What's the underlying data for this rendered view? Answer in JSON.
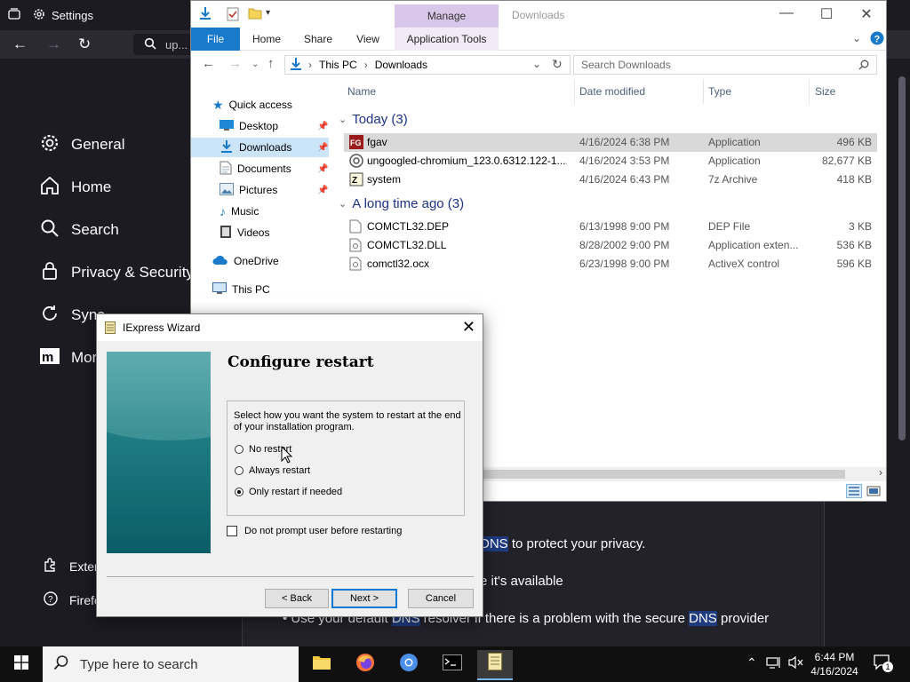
{
  "firefox": {
    "tab_title": "Settings",
    "url_partial": "up...",
    "categories": [
      "General",
      "Home",
      "Search",
      "Privacy & Security",
      "Sync",
      "More"
    ],
    "footer_links": [
      "Exter",
      "Firefo"
    ],
    "content": {
      "bullet1_highlight": "DNS",
      "bullet1_rest": " to protect your privacy.",
      "bullet2": "e it's available",
      "bullet3_a": "Use your default ",
      "bullet3_dns1": "DNS",
      "bullet3_b": " resolver if there is a problem with the secure ",
      "bullet3_dns2": "DNS",
      "bullet3_c": " provider"
    }
  },
  "explorer": {
    "window_title": "Downloads",
    "context_tab": "Manage",
    "ribbon_tabs": [
      "File",
      "Home",
      "Share",
      "View",
      "Application Tools"
    ],
    "breadcrumb": [
      "This PC",
      "Downloads"
    ],
    "search_placeholder": "Search Downloads",
    "columns": [
      "Name",
      "Date modified",
      "Type",
      "Size"
    ],
    "nav": [
      {
        "label": "Quick access",
        "pinned": false
      },
      {
        "label": "Desktop",
        "pinned": true
      },
      {
        "label": "Downloads",
        "pinned": true
      },
      {
        "label": "Documents",
        "pinned": true
      },
      {
        "label": "Pictures",
        "pinned": true
      },
      {
        "label": "Music",
        "pinned": false
      },
      {
        "label": "Videos",
        "pinned": false
      },
      {
        "label": "OneDrive",
        "pinned": false
      },
      {
        "label": "This PC",
        "pinned": false
      }
    ],
    "groups": [
      {
        "title": "Today (3)",
        "files": [
          {
            "name": "fgav",
            "date": "4/16/2024 6:38 PM",
            "type": "Application",
            "size": "496 KB"
          },
          {
            "name": "ungoogled-chromium_123.0.6312.122-1....",
            "date": "4/16/2024 3:53 PM",
            "type": "Application",
            "size": "82,677 KB"
          },
          {
            "name": "system",
            "date": "4/16/2024 6:43 PM",
            "type": "7z Archive",
            "size": "418 KB"
          }
        ]
      },
      {
        "title": "A long time ago (3)",
        "files": [
          {
            "name": "COMCTL32.DEP",
            "date": "6/13/1998 9:00 PM",
            "type": "DEP File",
            "size": "3 KB"
          },
          {
            "name": "COMCTL32.DLL",
            "date": "8/28/2002 9:00 PM",
            "type": "Application exten...",
            "size": "536 KB"
          },
          {
            "name": "comctl32.ocx",
            "date": "6/23/1998 9:00 PM",
            "type": "ActiveX control",
            "size": "596 KB"
          }
        ]
      }
    ]
  },
  "wizard": {
    "title": "IExpress Wizard",
    "heading": "Configure restart",
    "description": "Select how you want the system to restart at the end of your installation program.",
    "options": [
      "No restart",
      "Always restart",
      "Only restart if needed"
    ],
    "selected_option": "Only restart if needed",
    "checkbox_label": "Do not prompt user before restarting",
    "checkbox_checked": false,
    "buttons": {
      "back": "< Back",
      "next": "Next >",
      "cancel": "Cancel"
    }
  },
  "taskbar": {
    "search_placeholder": "Type here to search",
    "time": "6:44 PM",
    "date": "4/16/2024",
    "notification_count": "1"
  }
}
